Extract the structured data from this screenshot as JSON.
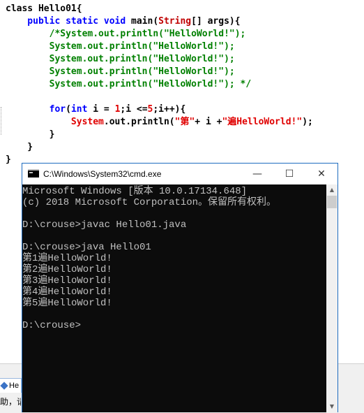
{
  "editor": {
    "lines": [
      {
        "parts": [
          {
            "t": "class ",
            "c": "plain"
          },
          {
            "t": "Hello01{",
            "c": "plain"
          }
        ]
      },
      {
        "parts": [
          {
            "t": "    public static void ",
            "c": "kw"
          },
          {
            "t": "main(",
            "c": "plain"
          },
          {
            "t": "String",
            "c": "type"
          },
          {
            "t": "[] args){",
            "c": "plain"
          }
        ]
      },
      {
        "parts": [
          {
            "t": "        /*System.out.println(\"HelloWorld!\");",
            "c": "cmt"
          }
        ]
      },
      {
        "parts": [
          {
            "t": "        System.out.println(\"HelloWorld!\");",
            "c": "cmt"
          }
        ]
      },
      {
        "parts": [
          {
            "t": "        System.out.println(\"HelloWorld!\");",
            "c": "cmt"
          }
        ]
      },
      {
        "parts": [
          {
            "t": "        System.out.println(\"HelloWorld!\");",
            "c": "cmt"
          }
        ]
      },
      {
        "parts": [
          {
            "t": "        System.out.println(\"HelloWorld!\"); */",
            "c": "cmt"
          }
        ]
      },
      {
        "parts": [
          {
            "t": "",
            "c": "plain"
          }
        ]
      },
      {
        "parts": [
          {
            "t": "        ",
            "c": "plain"
          },
          {
            "t": "for",
            "c": "kw"
          },
          {
            "t": "(",
            "c": "plain"
          },
          {
            "t": "int",
            "c": "kw"
          },
          {
            "t": " i = ",
            "c": "plain"
          },
          {
            "t": "1",
            "c": "red"
          },
          {
            "t": ";i <=",
            "c": "plain"
          },
          {
            "t": "5",
            "c": "red"
          },
          {
            "t": ";i++){",
            "c": "plain"
          }
        ]
      },
      {
        "parts": [
          {
            "t": "            ",
            "c": "plain"
          },
          {
            "t": "System",
            "c": "red"
          },
          {
            "t": ".out.println(",
            "c": "plain"
          },
          {
            "t": "\"第\"",
            "c": "red"
          },
          {
            "t": "+ i +",
            "c": "plain"
          },
          {
            "t": "\"遍HelloWorld!\"",
            "c": "red"
          },
          {
            "t": ");",
            "c": "plain"
          }
        ]
      },
      {
        "parts": [
          {
            "t": "        }",
            "c": "plain"
          }
        ]
      },
      {
        "parts": [
          {
            "t": "    }",
            "c": "plain"
          }
        ]
      },
      {
        "parts": [
          {
            "t": "}",
            "c": "plain"
          }
        ]
      }
    ]
  },
  "bottom": {
    "tab_label": "He",
    "status_text": "助，请"
  },
  "cmd": {
    "title": "C:\\Windows\\System32\\cmd.exe",
    "buttons": {
      "minimize": "—",
      "maximize": "☐",
      "close": "✕"
    },
    "console_lines": [
      "Microsoft Windows [版本 10.0.17134.648]",
      "(c) 2018 Microsoft Corporation。保留所有权利。",
      "",
      "D:\\crouse>javac Hello01.java",
      "",
      "D:\\crouse>java Hello01",
      "第1遍HelloWorld!",
      "第2遍HelloWorld!",
      "第3遍HelloWorld!",
      "第4遍HelloWorld!",
      "第5遍HelloWorld!",
      "",
      "D:\\crouse>"
    ],
    "scroll": {
      "up": "▲",
      "down": "▼"
    }
  },
  "colors": {
    "keyword": "#0000ff",
    "comment": "#008000",
    "type": "#c00000",
    "literal": "#e00000",
    "console_bg": "#0c0c0c",
    "console_fg": "#c0c0c0",
    "window_border": "#1e6cbf"
  }
}
